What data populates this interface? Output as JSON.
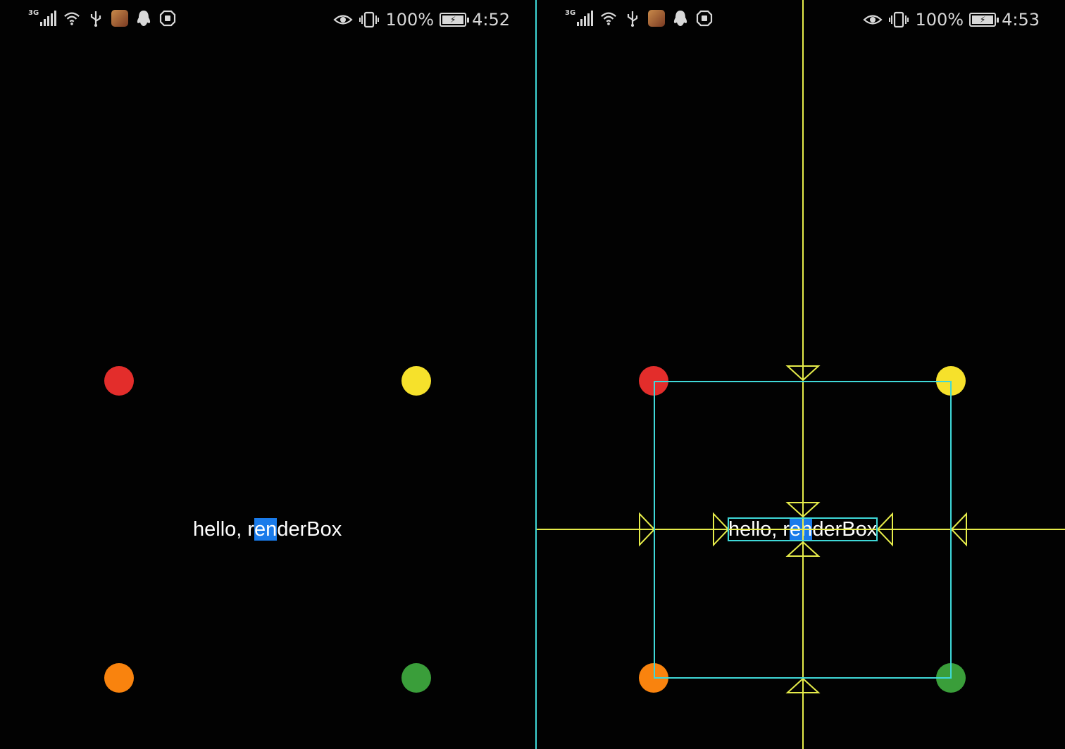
{
  "screens": [
    {
      "id": "left",
      "status": {
        "network": "3G",
        "battery_pct": "100%",
        "time": "4:52"
      },
      "text": {
        "before": "hello, r",
        "selected": "en",
        "after": "derBox"
      },
      "dots": [
        "red",
        "yellow",
        "orange",
        "green"
      ],
      "debug_paint": false
    },
    {
      "id": "right",
      "status": {
        "network": "3G",
        "battery_pct": "100%",
        "time": "4:53"
      },
      "text": {
        "before": "hello, r",
        "selected": "en",
        "after": "derBox"
      },
      "dots": [
        "red",
        "yellow",
        "orange",
        "green"
      ],
      "debug_paint": true
    }
  ],
  "colors": {
    "red": "#e32d2b",
    "yellow": "#f6e12b",
    "orange": "#f9830e",
    "green": "#3a9e3a",
    "selection": "#1a7bea",
    "debug_cyan": "#3fd8d8",
    "debug_yellow": "#e6ec4a"
  },
  "icons": [
    "signal-icon",
    "wifi-icon",
    "usb-icon",
    "app-icon",
    "qq-icon",
    "shield-icon",
    "eye-icon",
    "vibrate-icon",
    "battery-icon"
  ]
}
